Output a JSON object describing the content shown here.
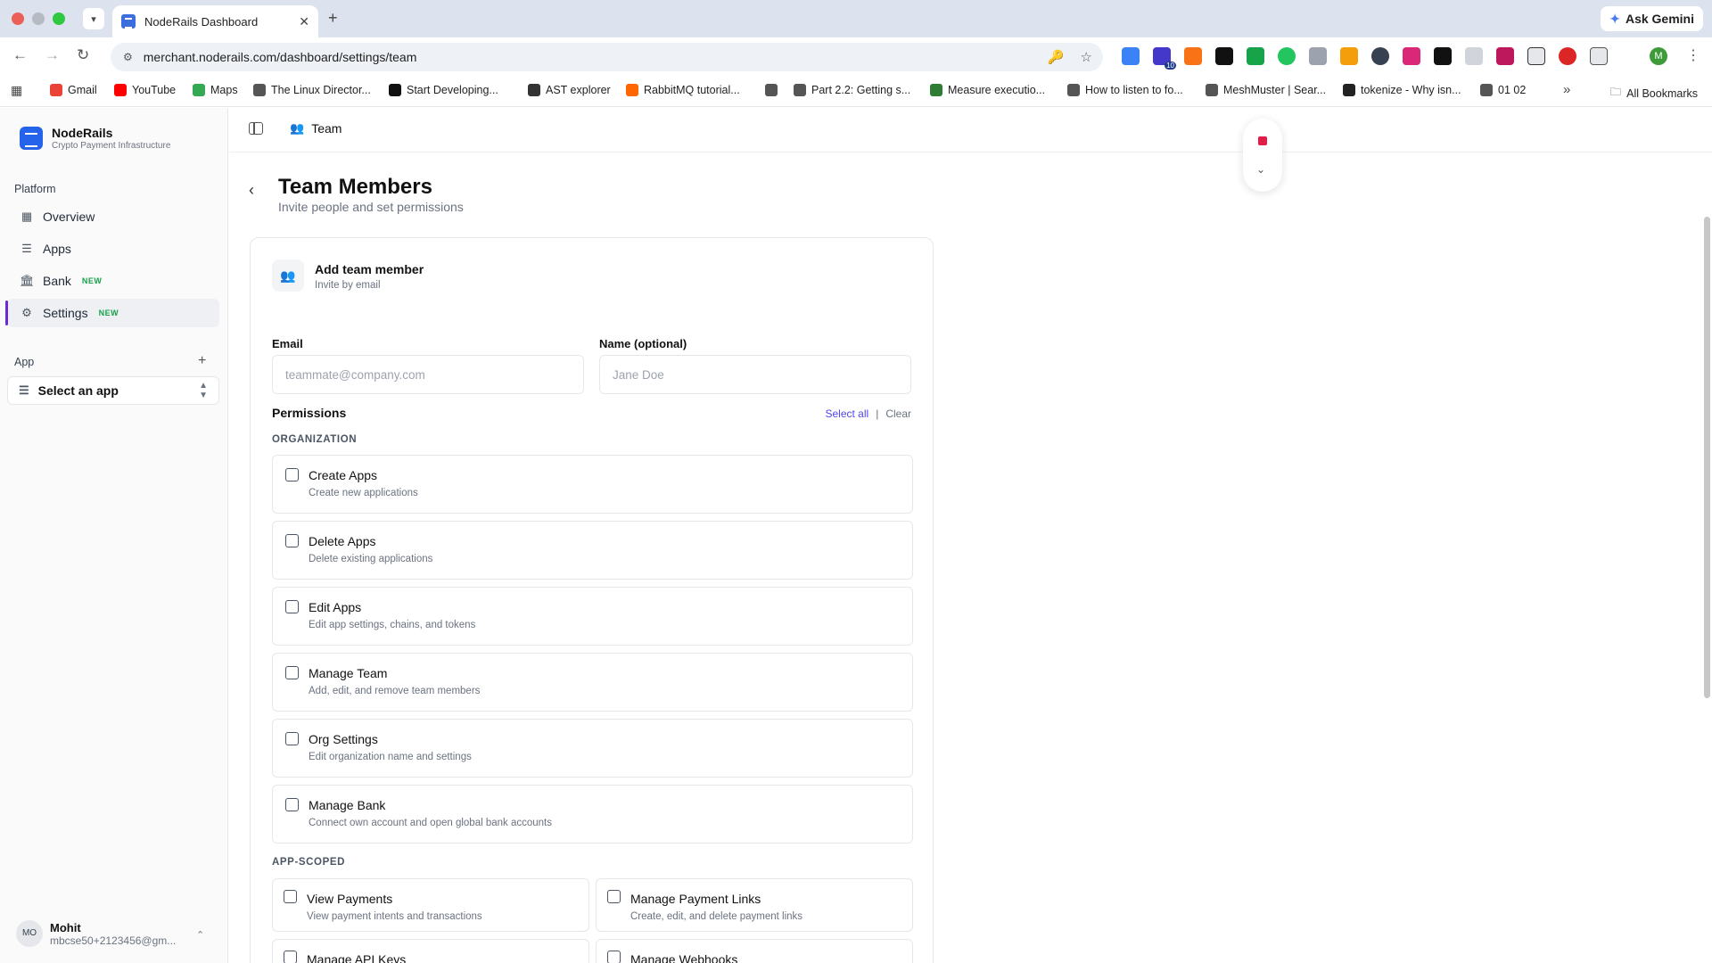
{
  "browser": {
    "tab_title": "NodeRails Dashboard",
    "url": "merchant.noderails.com/dashboard/settings/team",
    "gemini_label": "Ask Gemini",
    "profile_initial": "M",
    "ext_badge": "10",
    "bookmarks": [
      {
        "label": "Gmail",
        "color": "#ea4335"
      },
      {
        "label": "YouTube",
        "color": "#ff0000"
      },
      {
        "label": "Maps",
        "color": "#34a853"
      },
      {
        "label": "The Linux Director...",
        "color": "#555555"
      },
      {
        "label": "Start Developing...",
        "color": "#111111"
      },
      {
        "label": "AST explorer",
        "color": "#333333"
      },
      {
        "label": "RabbitMQ tutorial...",
        "color": "#ff6600"
      },
      {
        "label": "",
        "color": "#555555"
      },
      {
        "label": "Part 2.2: Getting s...",
        "color": "#555555"
      },
      {
        "label": "Measure executio...",
        "color": "#2e7d32"
      },
      {
        "label": "How to listen to fo...",
        "color": "#555555"
      },
      {
        "label": "MeshMuster | Sear...",
        "color": "#555555"
      },
      {
        "label": "tokenize - Why isn...",
        "color": "#222222"
      },
      {
        "label": "01 02",
        "color": "#555555"
      }
    ],
    "all_bookmarks": "All Bookmarks"
  },
  "sidebar": {
    "brand_name": "NodeRails",
    "brand_sub": "Crypto Payment Infrastructure",
    "platform_label": "Platform",
    "items": [
      {
        "label": "Overview",
        "icon": "grid-icon",
        "badge": ""
      },
      {
        "label": "Apps",
        "icon": "layers-icon",
        "badge": ""
      },
      {
        "label": "Bank",
        "icon": "bank-icon",
        "badge": "NEW"
      },
      {
        "label": "Settings",
        "icon": "gear-icon",
        "badge": "NEW",
        "active": true
      }
    ],
    "app_label": "App",
    "select_app": "Select an app",
    "user_initials": "MO",
    "user_name": "Mohit",
    "user_email": "mbcse50+2123456@gm..."
  },
  "header": {
    "breadcrumb": "Team"
  },
  "page": {
    "title": "Team Members",
    "subtitle": "Invite people and set permissions"
  },
  "form": {
    "card_title": "Add team member",
    "card_sub": "Invite by email",
    "email_label": "Email",
    "email_placeholder": "teammate@company.com",
    "email_value": "",
    "name_label": "Name (optional)",
    "name_placeholder": "Jane Doe",
    "name_value": "",
    "permissions_label": "Permissions",
    "select_all": "Select all",
    "separator": "|",
    "clear": "Clear",
    "org_label": "ORGANIZATION",
    "app_scoped_label": "APP-SCOPED",
    "org_permissions": [
      {
        "name": "Create Apps",
        "desc": "Create new applications",
        "checked": false
      },
      {
        "name": "Delete Apps",
        "desc": "Delete existing applications",
        "checked": false
      },
      {
        "name": "Edit Apps",
        "desc": "Edit app settings, chains, and tokens",
        "checked": false
      },
      {
        "name": "Manage Team",
        "desc": "Add, edit, and remove team members",
        "checked": false
      },
      {
        "name": "Org Settings",
        "desc": "Edit organization name and settings",
        "checked": false
      },
      {
        "name": "Manage Bank",
        "desc": "Connect own account and open global bank accounts",
        "checked": false
      }
    ],
    "app_permissions": [
      {
        "name": "View Payments",
        "desc": "View payment intents and transactions",
        "checked": false
      },
      {
        "name": "Manage Payment Links",
        "desc": "Create, edit, and delete payment links",
        "checked": false
      },
      {
        "name": "Manage API Keys",
        "desc": "",
        "checked": false
      },
      {
        "name": "Manage Webhooks",
        "desc": "",
        "checked": false
      }
    ]
  }
}
